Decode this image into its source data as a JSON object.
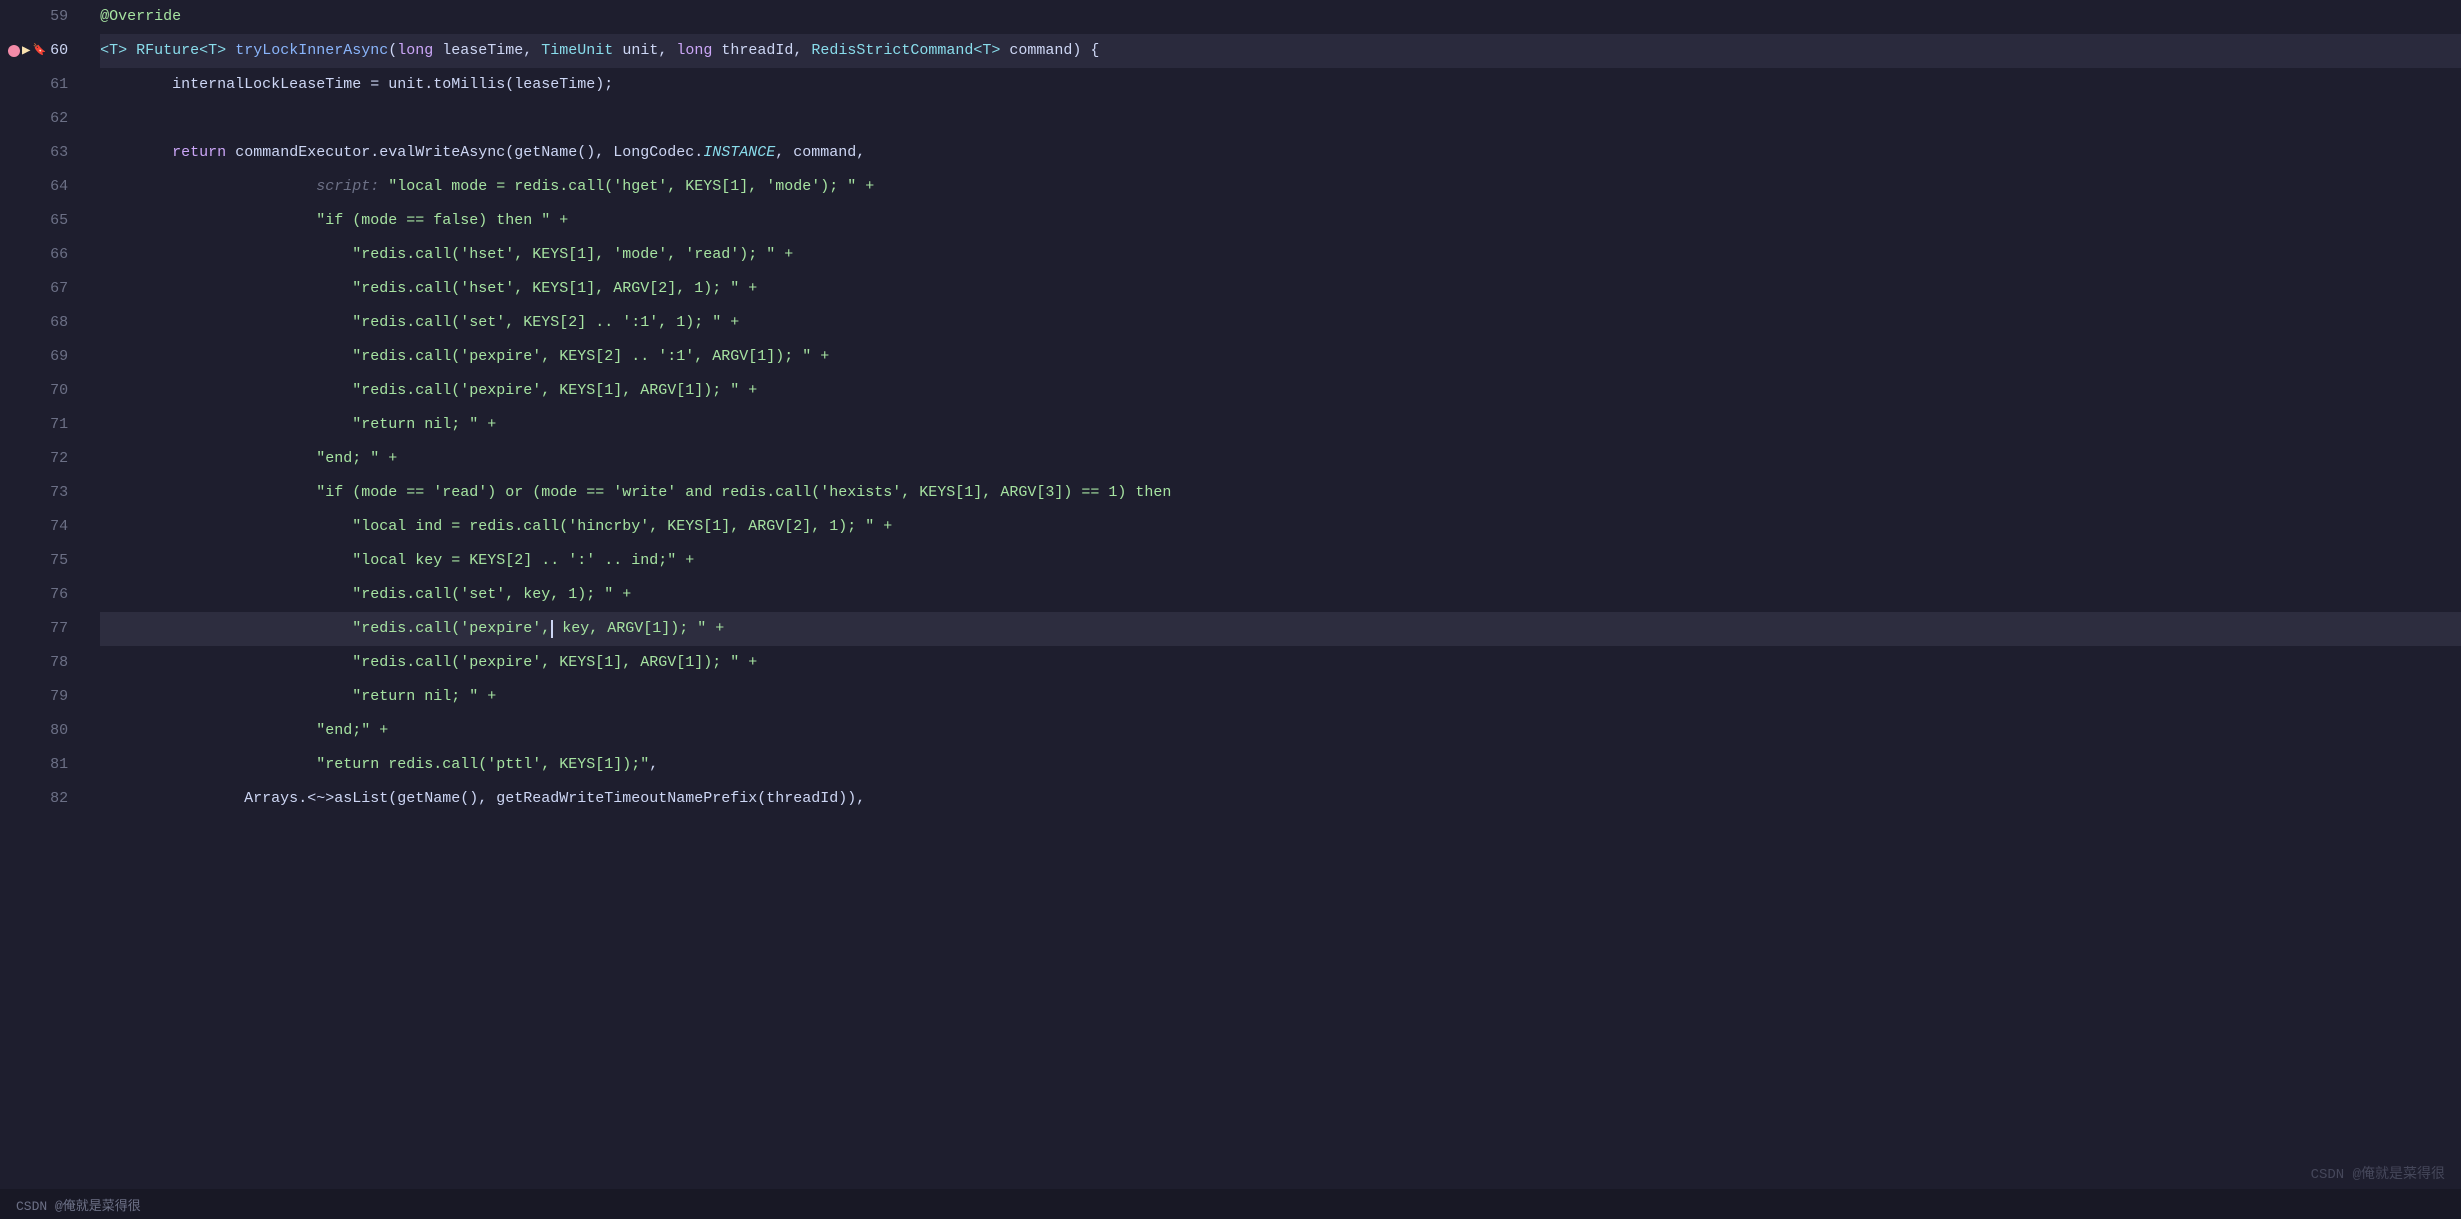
{
  "editor": {
    "background": "#1e1e2e",
    "watermark": "CSDN @俺就是菜得很",
    "lines": [
      {
        "num": "59",
        "content_parts": [
          {
            "text": "@Override",
            "class": "annotation"
          }
        ],
        "active": false,
        "breakpoint": false,
        "debug": false,
        "bookmark": false
      },
      {
        "num": "60",
        "content_parts": [
          {
            "text": "<T> ",
            "class": "type"
          },
          {
            "text": "RFuture<T> ",
            "class": "type"
          },
          {
            "text": "tryLockInnerAsync",
            "class": "method"
          },
          {
            "text": "(",
            "class": "punct"
          },
          {
            "text": "long ",
            "class": "kw"
          },
          {
            "text": "leaseTime, ",
            "class": "param-name"
          },
          {
            "text": "TimeUnit ",
            "class": "type"
          },
          {
            "text": "unit, ",
            "class": "param-name"
          },
          {
            "text": "long ",
            "class": "kw"
          },
          {
            "text": "threadId, ",
            "class": "param-name"
          },
          {
            "text": "RedisStrictCommand<T> ",
            "class": "type"
          },
          {
            "text": "command) {",
            "class": "param-name"
          }
        ],
        "active": true,
        "breakpoint": true,
        "debug": true,
        "bookmark": true
      },
      {
        "num": "61",
        "content_parts": [
          {
            "text": "        internalLockLeaseTime = unit.toMillis(leaseTime);",
            "class": "normal"
          }
        ],
        "active": false
      },
      {
        "num": "62",
        "content_parts": [],
        "active": false
      },
      {
        "num": "63",
        "content_parts": [
          {
            "text": "        ",
            "class": "normal"
          },
          {
            "text": "return ",
            "class": "kw"
          },
          {
            "text": "commandExecutor.evalWriteAsync(getName(), LongCodec.",
            "class": "normal"
          },
          {
            "text": "INSTANCE",
            "class": "italic-type"
          },
          {
            "text": ", command,",
            "class": "normal"
          }
        ],
        "active": false
      },
      {
        "num": "64",
        "content_parts": [
          {
            "text": "                        ",
            "class": "normal"
          },
          {
            "text": "script: ",
            "class": "script-label"
          },
          {
            "text": "\"local mode = redis.call('hget', KEYS[1], 'mode'); \" +",
            "class": "string"
          }
        ],
        "active": false
      },
      {
        "num": "65",
        "content_parts": [
          {
            "text": "                        ",
            "class": "normal"
          },
          {
            "text": "\"if (mode == false) then \" +",
            "class": "string"
          }
        ],
        "active": false
      },
      {
        "num": "66",
        "content_parts": [
          {
            "text": "                            ",
            "class": "normal"
          },
          {
            "text": "\"redis.call('hset', KEYS[1], 'mode', 'read'); \" +",
            "class": "string"
          }
        ],
        "active": false
      },
      {
        "num": "67",
        "content_parts": [
          {
            "text": "                            ",
            "class": "normal"
          },
          {
            "text": "\"redis.call('hset', KEYS[1], ARGV[2], 1); \" +",
            "class": "string"
          }
        ],
        "active": false
      },
      {
        "num": "68",
        "content_parts": [
          {
            "text": "                            ",
            "class": "normal"
          },
          {
            "text": "\"redis.call('set', KEYS[2] .. ':1', 1); \" +",
            "class": "string"
          }
        ],
        "active": false
      },
      {
        "num": "69",
        "content_parts": [
          {
            "text": "                            ",
            "class": "normal"
          },
          {
            "text": "\"redis.call('pexpire', KEYS[2] .. ':1', ARGV[1]); \" +",
            "class": "string"
          }
        ],
        "active": false
      },
      {
        "num": "70",
        "content_parts": [
          {
            "text": "                            ",
            "class": "normal"
          },
          {
            "text": "\"redis.call('pexpire', KEYS[1], ARGV[1]); \" +",
            "class": "string"
          }
        ],
        "active": false
      },
      {
        "num": "71",
        "content_parts": [
          {
            "text": "                            ",
            "class": "normal"
          },
          {
            "text": "\"return nil; \" +",
            "class": "string"
          }
        ],
        "active": false
      },
      {
        "num": "72",
        "content_parts": [
          {
            "text": "                        ",
            "class": "normal"
          },
          {
            "text": "\"end; \" +",
            "class": "string"
          }
        ],
        "active": false
      },
      {
        "num": "73",
        "content_parts": [
          {
            "text": "                        ",
            "class": "normal"
          },
          {
            "text": "\"if (mode == 'read') or (mode == 'write' and redis.call('hexists', KEYS[1], ARGV[3]) == 1) then",
            "class": "string"
          }
        ],
        "active": false
      },
      {
        "num": "74",
        "content_parts": [
          {
            "text": "                            ",
            "class": "normal"
          },
          {
            "text": "\"local ind = redis.call('hincrby', KEYS[1], ARGV[2], 1); \" +",
            "class": "string"
          }
        ],
        "active": false
      },
      {
        "num": "75",
        "content_parts": [
          {
            "text": "                            ",
            "class": "normal"
          },
          {
            "text": "\"local key = KEYS[2] .. ':' .. ind;\" +",
            "class": "string"
          }
        ],
        "active": false
      },
      {
        "num": "76",
        "content_parts": [
          {
            "text": "                            ",
            "class": "normal"
          },
          {
            "text": "\"redis.call('set', key, 1); \" +",
            "class": "string"
          }
        ],
        "active": false
      },
      {
        "num": "77",
        "content_parts": [
          {
            "text": "                            ",
            "class": "normal"
          },
          {
            "text": "\"redis.call('pexpire', key, ARGV[1]); \" +",
            "class": "string"
          }
        ],
        "active": false,
        "cursor": true
      },
      {
        "num": "78",
        "content_parts": [
          {
            "text": "                            ",
            "class": "normal"
          },
          {
            "text": "\"redis.call('pexpire', KEYS[1], ARGV[1]); \" +",
            "class": "string"
          }
        ],
        "active": false
      },
      {
        "num": "79",
        "content_parts": [
          {
            "text": "                            ",
            "class": "normal"
          },
          {
            "text": "\"return nil; \" +",
            "class": "string"
          }
        ],
        "active": false
      },
      {
        "num": "80",
        "content_parts": [
          {
            "text": "                        ",
            "class": "normal"
          },
          {
            "text": "\"end;\" +",
            "class": "string"
          }
        ],
        "active": false
      },
      {
        "num": "81",
        "content_parts": [
          {
            "text": "                        ",
            "class": "normal"
          },
          {
            "text": "\"return redis.call('pttl', KEYS[1]);\"",
            "class": "string"
          },
          {
            "text": ",",
            "class": "normal"
          }
        ],
        "active": false
      },
      {
        "num": "82",
        "content_parts": [
          {
            "text": "                Arrays.<~>asList(getName(), getReadWriteTimeoutNamePrefix(threadId)),",
            "class": "normal"
          }
        ],
        "active": false
      }
    ]
  }
}
